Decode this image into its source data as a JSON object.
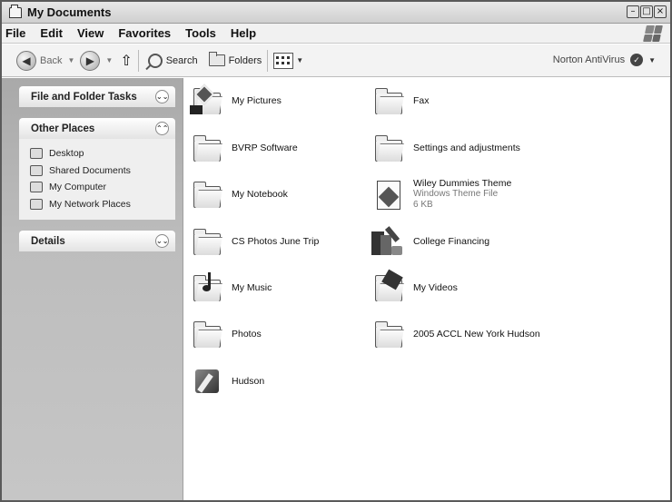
{
  "window": {
    "title": "My Documents"
  },
  "menu": [
    "File",
    "Edit",
    "View",
    "Favorites",
    "Tools",
    "Help"
  ],
  "toolbar": {
    "back_label": "Back",
    "search_label": "Search",
    "folders_label": "Folders",
    "norton_label": "Norton AntiVirus"
  },
  "sidebar": {
    "file_folder_tasks": "File and Folder Tasks",
    "other_places": {
      "title": "Other Places",
      "items": [
        "Desktop",
        "Shared Documents",
        "My Computer",
        "My Network Places"
      ]
    },
    "details": "Details"
  },
  "files": [
    {
      "name": "My Pictures",
      "icon": "my-pictures-icon"
    },
    {
      "name": "Fax",
      "icon": "folder-icon"
    },
    {
      "name": "BVRP Software",
      "icon": "folder-icon"
    },
    {
      "name": "Settings and adjustments",
      "icon": "folder-icon"
    },
    {
      "name": "My Notebook",
      "icon": "folder-icon"
    },
    {
      "name": "Wiley Dummies Theme",
      "type": "Windows Theme File",
      "size": "6 KB",
      "icon": "theme-file-icon"
    },
    {
      "name": "CS Photos June Trip",
      "icon": "folder-icon"
    },
    {
      "name": "College Financing",
      "icon": "shortcut-icon"
    },
    {
      "name": "My Music",
      "icon": "my-music-icon"
    },
    {
      "name": "My Videos",
      "icon": "my-videos-icon"
    },
    {
      "name": "Photos",
      "icon": "folder-icon"
    },
    {
      "name": "2005 ACCL New York Hudson",
      "icon": "folder-icon"
    },
    {
      "name": "Hudson",
      "icon": "app-icon"
    }
  ]
}
